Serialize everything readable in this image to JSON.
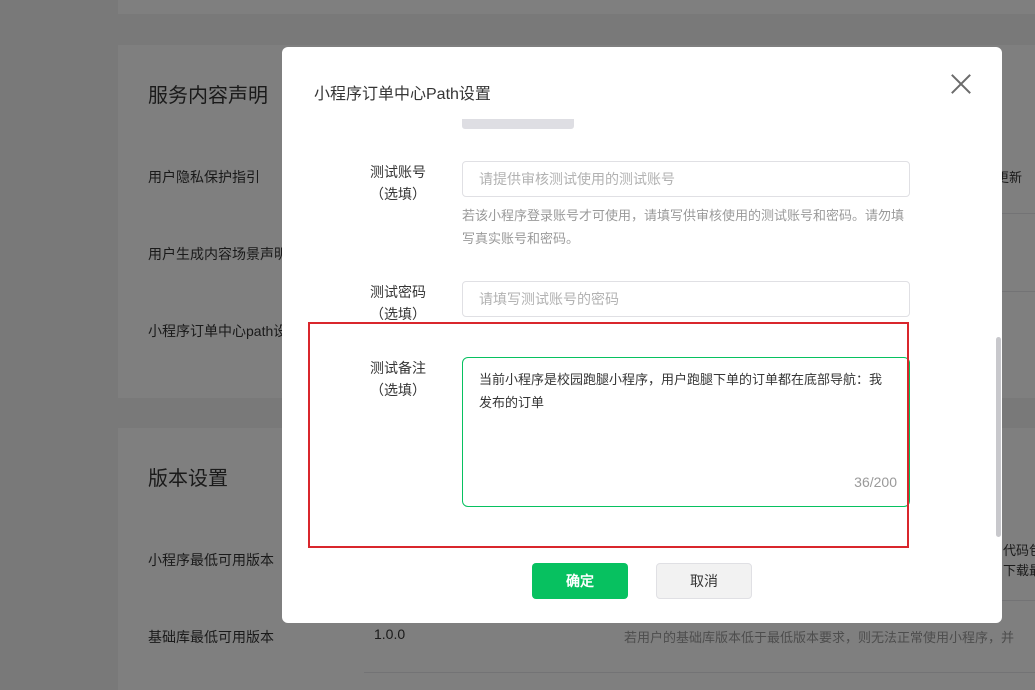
{
  "background": {
    "service_title": "服务内容声明",
    "rows": [
      {
        "label": "用户隐私保护指引",
        "side": "况更新"
      },
      {
        "label": "用户生成内容场景声明"
      },
      {
        "label": "小程序订单中心path设"
      }
    ],
    "version_title": "版本设置",
    "version_rows": [
      {
        "label": "小程序最低可用版本（",
        "side1": "代码包",
        "side2": "下载最"
      },
      {
        "label": "基础库最低可用版本",
        "value": "1.0.0",
        "desc": "若用户的基础库版本低于最低版本要求，则无法正常使用小程序，并"
      }
    ]
  },
  "dialog": {
    "title": "小程序订单中心Path设置",
    "close_icon": "close-icon",
    "test_account": {
      "label_line1": "测试账号",
      "label_line2": "（选填）",
      "placeholder": "请提供审核测试使用的测试账号",
      "hint": "若该小程序登录账号才可使用，请填写供审核使用的测试账号和密码。请勿填写真实账号和密码。"
    },
    "test_password": {
      "label_line1": "测试密码",
      "label_line2": "（选填）",
      "placeholder": "请填写测试账号的密码"
    },
    "test_note": {
      "label_line1": "测试备注",
      "label_line2": "（选填）",
      "value": "当前小程序是校园跑腿小程序，用户跑腿下单的订单都在底部导航：我发布的订单",
      "counter": "36/200"
    },
    "confirm_label": "确定",
    "cancel_label": "取消"
  },
  "colors": {
    "accent": "#07c160",
    "highlight": "#d9262c"
  }
}
